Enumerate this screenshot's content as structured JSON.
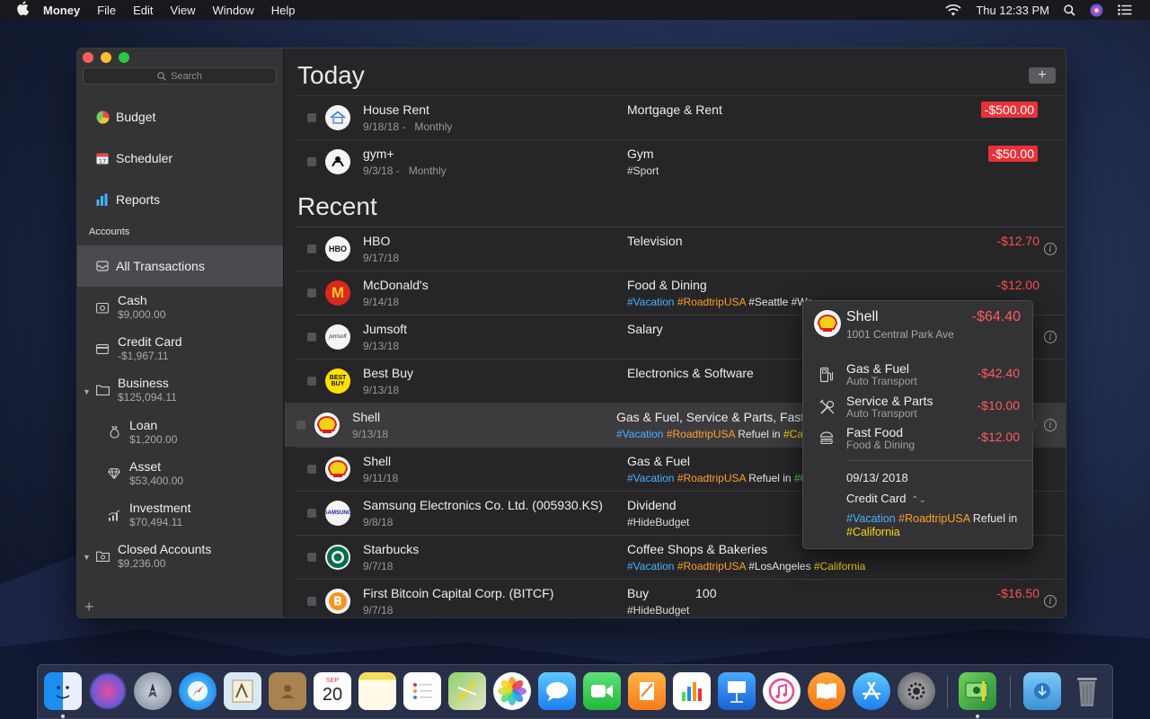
{
  "menubar": {
    "app": "Money",
    "items": [
      "File",
      "Edit",
      "View",
      "Window",
      "Help"
    ],
    "clock": "Thu 12:33 PM"
  },
  "sidebar": {
    "search_placeholder": "Search",
    "nav": [
      {
        "label": "Budget",
        "icon": "budget-icon"
      },
      {
        "label": "Scheduler",
        "icon": "calendar-icon"
      },
      {
        "label": "Reports",
        "icon": "bar-chart-icon"
      }
    ],
    "accounts_label": "Accounts",
    "all_transactions": "All Transactions",
    "accounts": [
      {
        "name": "Cash",
        "amount": "$9,000.00"
      },
      {
        "name": "Credit Card",
        "amount": "-$1,967.11"
      },
      {
        "name": "Business",
        "amount": "$125,094.11"
      },
      {
        "name": "Loan",
        "amount": "$1,200.00"
      },
      {
        "name": "Asset",
        "amount": "$53,400.00"
      },
      {
        "name": "Investment",
        "amount": "$70,494.11"
      },
      {
        "name": "Closed Accounts",
        "amount": "$9,236.00"
      }
    ],
    "add": "+"
  },
  "main": {
    "today_title": "Today",
    "recent_title": "Recent",
    "add_button": "+",
    "today": [
      {
        "payee": "House Rent",
        "date": "9/18/18 -",
        "repeat": "Monthly",
        "category": "Mortgage & Rent",
        "amount": "-$500.00"
      },
      {
        "payee": "gym+",
        "date": "9/3/18 -",
        "repeat": "Monthly",
        "category": "Gym",
        "tag": "#Sport",
        "amount": "-$50.00"
      }
    ],
    "recent": [
      {
        "payee": "HBO",
        "date": "9/17/18",
        "category": "Television",
        "amount": "-$12.70"
      },
      {
        "payee": "McDonald's",
        "date": "9/14/18",
        "category": "Food & Dining",
        "amount": "-$12.00",
        "tags": [
          "#Vacation",
          "#RoadtripUSA",
          "#Seattle",
          "#Wa"
        ]
      },
      {
        "payee": "Jumsoft",
        "date": "9/13/18",
        "category": "Salary"
      },
      {
        "payee": "Best Buy",
        "date": "9/13/18",
        "category": "Electronics & Software"
      },
      {
        "payee": "Shell",
        "date": "9/13/18",
        "category": "Gas & Fuel, Service & Parts, Fast",
        "tags": [
          "#Vacation",
          "#RoadtripUSA",
          "Refuel in",
          "#Ca"
        ]
      },
      {
        "payee": "Shell",
        "date": "9/11/18",
        "category": "Gas & Fuel",
        "tags": [
          "#Vacation",
          "#RoadtripUSA",
          "Refuel in",
          "#Or"
        ]
      },
      {
        "payee": "Samsung Electronics Co. Ltd. (005930.KS)",
        "date": "9/8/18",
        "category": "Dividend",
        "tags": [
          "#HideBudget"
        ]
      },
      {
        "payee": "Starbucks",
        "date": "9/7/18",
        "category": "Coffee Shops & Bakeries",
        "tags": [
          "#Vacation",
          "#RoadtripUSA",
          "#LosAngeles",
          "#California"
        ]
      },
      {
        "payee": "First Bitcoin Capital Corp. (BITCF)",
        "date": "9/7/18",
        "category": "Buy",
        "quantity": "100",
        "amount": "-$16.50",
        "tags": [
          "#HideBudget"
        ]
      }
    ]
  },
  "popover": {
    "payee": "Shell",
    "address": "1001 Central Park Ave",
    "total": "-$64.40",
    "splits": [
      {
        "name": "Gas & Fuel",
        "sub": "Auto Transport",
        "amount": "-$42.40"
      },
      {
        "name": "Service & Parts",
        "sub": "Auto Transport",
        "amount": "-$10.00"
      },
      {
        "name": "Fast Food",
        "sub": "Food & Dining",
        "amount": "-$12.00"
      }
    ],
    "date": "09/13/ 2018",
    "account": "Credit Card",
    "tags": {
      "t1": "#Vacation",
      "t2": "#RoadtripUSA",
      "t3": "Refuel",
      "t4": "in",
      "t5": "#California"
    }
  },
  "colors": {
    "accent_red": "#e8323a",
    "tag_blue": "#4ab0ff",
    "tag_orange": "#ff9f2a",
    "tag_green": "#4cd964",
    "tag_yellow": "#ffd60a"
  }
}
